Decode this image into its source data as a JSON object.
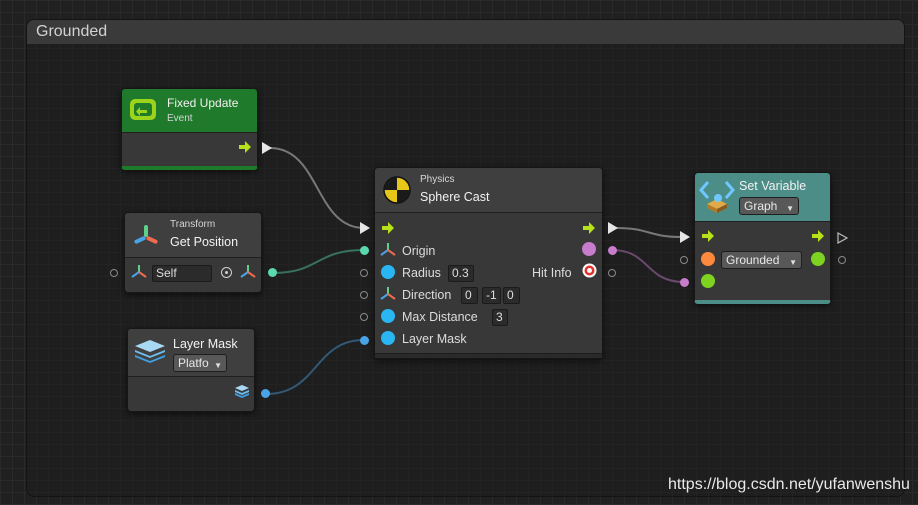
{
  "group": {
    "title": "Grounded"
  },
  "fixed_update": {
    "title": "Fixed Update",
    "subtitle": "Event"
  },
  "get_position": {
    "category": "Transform",
    "title": "Get Position",
    "target_value": "Self"
  },
  "layer_mask": {
    "title": "Layer Mask",
    "value": "Platfo"
  },
  "sphere_cast": {
    "category": "Physics",
    "title": "Sphere Cast",
    "origin_label": "Origin",
    "radius_label": "Radius",
    "radius_value": "0.3",
    "direction_label": "Direction",
    "direction_x": "0",
    "direction_y": "-1",
    "direction_z": "0",
    "max_distance_label": "Max Distance",
    "max_distance_value": "3",
    "layer_mask_label": "Layer Mask",
    "hit_info_label": "Hit Info"
  },
  "set_variable": {
    "title": "Set Variable",
    "kind": "Graph",
    "name": "Grounded"
  },
  "watermark": "https://blog.csdn.net/yufanwenshu",
  "colors": {
    "event_green": "#1f7a2b",
    "setvar_teal": "#4c8e87",
    "flow_arrow": "#b7e11a",
    "vector3_wire": "#5bd8b0",
    "layermask_wire": "#4aa3e4",
    "raycasthit_wire": "#c77ccc",
    "float_port": "#29b6f2",
    "bool_port": "#7ed321",
    "object_port": "#ff8a3d"
  }
}
